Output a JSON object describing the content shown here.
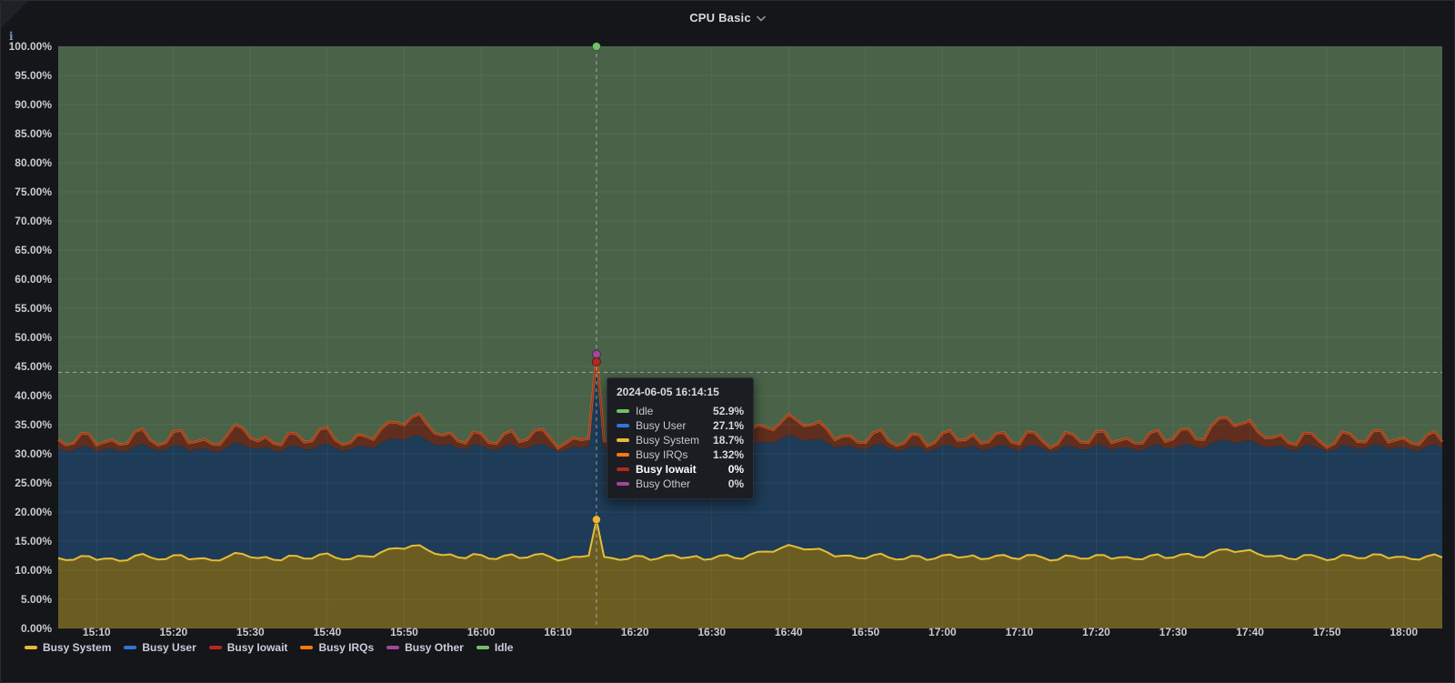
{
  "header": {
    "title": "CPU Basic",
    "info_icon_text": "i",
    "title_chevron_icon": "chevron-down"
  },
  "colors": {
    "panel_bg": "#141619",
    "panel_border": "#2b2c33",
    "axis_text": "#c9cbd1",
    "grid": "rgba(255,255,255,0.06)",
    "crosshair": "#b9c0c7",
    "tooltip_bg": "#1b1d23",
    "series": {
      "busy_system": "#EAB839",
      "busy_user": "#3274D9",
      "busy_iowait": "#B7271F",
      "busy_irqs": "#FF780A",
      "busy_other": "#A0479C",
      "idle": "#73BF69"
    },
    "fills": {
      "idle": "#4a6348",
      "busy_user": "#1e3b57",
      "busy_system": "#6b5d22",
      "iowait_irqs_fringe": "#5f2e1e"
    },
    "strokes": {
      "busy_system_line": "#e6bd37",
      "fringe_orange": "#d06a1f",
      "fringe_red": "#a03320"
    }
  },
  "tooltip": {
    "timestamp": "2024-06-05 16:14:15",
    "rows": [
      {
        "label": "Idle",
        "value": "52.9%",
        "color": "#73BF69",
        "bold": false
      },
      {
        "label": "Busy User",
        "value": "27.1%",
        "color": "#3274D9",
        "bold": false
      },
      {
        "label": "Busy System",
        "value": "18.7%",
        "color": "#EAB839",
        "bold": false
      },
      {
        "label": "Busy IRQs",
        "value": "1.32%",
        "color": "#FF780A",
        "bold": false
      },
      {
        "label": "Busy Iowait",
        "value": "0%",
        "color": "#B7271F",
        "bold": true
      },
      {
        "label": "Busy Other",
        "value": "0%",
        "color": "#A0479C",
        "bold": false
      }
    ]
  },
  "legend": {
    "items": [
      {
        "label": "Busy System",
        "color": "#EAB839"
      },
      {
        "label": "Busy User",
        "color": "#3274D9"
      },
      {
        "label": "Busy Iowait",
        "color": "#B7271F"
      },
      {
        "label": "Busy IRQs",
        "color": "#FF780A"
      },
      {
        "label": "Busy Other",
        "color": "#A0479C"
      },
      {
        "label": "Idle",
        "color": "#73BF69"
      }
    ]
  },
  "chart_data": {
    "type": "area",
    "stacked": true,
    "title": "CPU Basic",
    "unit": "percent",
    "ylim": [
      0,
      100
    ],
    "y_tick_step_pct": 5,
    "time_start": "15:05",
    "time_end": "18:05",
    "step_minutes": 2,
    "x_ticks": [
      "15:10",
      "15:20",
      "15:30",
      "15:40",
      "15:50",
      "16:00",
      "16:10",
      "16:20",
      "16:30",
      "16:40",
      "16:50",
      "17:00",
      "17:10",
      "17:20",
      "17:30",
      "17:40",
      "17:50",
      "18:00"
    ],
    "y_ticks": [
      "100.00%",
      "95.00%",
      "90.00%",
      "85.00%",
      "80.00%",
      "75.00%",
      "70.00%",
      "65.00%",
      "60.00%",
      "55.00%",
      "50.00%",
      "45.00%",
      "40.00%",
      "35.00%",
      "30.00%",
      "25.00%",
      "20.00%",
      "15.00%",
      "10.00%",
      "5.00%",
      "0.00%"
    ],
    "stack_tops": {
      "busy_system_pct": [
        12.1,
        11.8,
        12.4,
        12.0,
        11.6,
        12.5,
        12.2,
        11.9,
        12.6,
        12.0,
        11.7,
        12.3,
        12.8,
        12.1,
        11.8,
        12.5,
        12.0,
        12.7,
        12.2,
        11.9,
        12.4,
        13.1,
        13.8,
        14.2,
        13.5,
        12.6,
        12.2,
        12.8,
        12.0,
        12.5,
        12.1,
        12.7,
        12.3,
        11.9,
        12.3,
        18.7,
        12.1,
        11.9,
        12.4,
        12.0,
        12.6,
        12.2,
        11.8,
        12.5,
        12.1,
        12.7,
        13.2,
        13.8,
        14.0,
        13.6,
        13.1,
        12.5,
        12.1,
        12.6,
        12.2,
        11.9,
        12.4,
        12.0,
        12.7,
        12.3,
        11.9,
        12.5,
        12.1,
        12.6,
        12.2,
        11.8,
        12.4,
        12.0,
        12.6,
        12.2,
        11.9,
        12.5,
        12.1,
        12.7,
        12.3,
        13.0,
        13.6,
        13.3,
        12.8,
        12.4,
        12.0,
        12.6,
        12.2,
        11.9,
        12.5,
        12.1,
        12.7,
        12.3,
        11.9,
        12.4,
        12.2
      ],
      "busy_user_cum_pct": [
        30.9,
        30.6,
        31.2,
        30.8,
        30.5,
        31.3,
        31.0,
        30.7,
        31.4,
        30.8,
        30.5,
        31.1,
        31.6,
        30.9,
        30.6,
        31.3,
        30.8,
        31.5,
        31.0,
        30.7,
        31.2,
        31.9,
        32.6,
        33.0,
        32.3,
        31.4,
        31.0,
        31.6,
        30.8,
        31.3,
        30.9,
        31.5,
        31.1,
        30.7,
        31.1,
        45.8,
        30.9,
        30.7,
        31.2,
        30.8,
        31.4,
        31.0,
        30.6,
        31.3,
        30.9,
        31.5,
        32.0,
        32.6,
        32.8,
        32.4,
        31.9,
        31.3,
        30.9,
        31.4,
        31.0,
        30.7,
        31.2,
        30.8,
        31.5,
        31.1,
        30.7,
        31.3,
        30.9,
        31.4,
        31.0,
        30.6,
        31.2,
        30.8,
        31.4,
        31.0,
        30.7,
        31.3,
        30.9,
        31.5,
        31.1,
        31.8,
        32.4,
        32.1,
        31.6,
        31.2,
        30.8,
        31.4,
        31.0,
        30.7,
        31.3,
        30.9,
        31.5,
        31.1,
        30.7,
        31.2,
        31.0
      ],
      "busy_total_cum_pct": [
        32.4,
        31.8,
        33.4,
        32.0,
        31.6,
        33.8,
        32.3,
        31.9,
        34.0,
        32.1,
        31.7,
        33.2,
        34.4,
        32.2,
        31.8,
        33.6,
        32.0,
        34.2,
        32.4,
        31.9,
        33.0,
        34.3,
        35.4,
        36.3,
        35.0,
        33.2,
        32.2,
        33.8,
        31.9,
        33.4,
        32.1,
        34.0,
        32.6,
        31.8,
        32.4,
        47.1,
        32.0,
        31.8,
        33.2,
        31.9,
        33.8,
        32.3,
        31.7,
        33.5,
        32.0,
        34.1,
        34.6,
        35.4,
        35.8,
        35.0,
        34.2,
        33.0,
        32.0,
        33.6,
        32.2,
        31.8,
        33.2,
        31.9,
        34.0,
        32.4,
        31.8,
        33.5,
        32.0,
        33.8,
        32.2,
        31.7,
        33.3,
        31.9,
        33.9,
        32.3,
        31.8,
        33.6,
        32.1,
        34.2,
        32.5,
        34.8,
        36.2,
        35.2,
        33.8,
        32.8,
        31.9,
        33.6,
        32.2,
        31.8,
        33.4,
        32.0,
        34.0,
        32.4,
        31.8,
        33.2,
        32.1
      ]
    },
    "idle_top_pct": 100,
    "hover": {
      "date_time": "2024-06-05 16:14:15",
      "crosshair_time": "16:15:00",
      "crosshair_y_pct": 44,
      "points": [
        {
          "series": "Idle",
          "stack_pct": 100,
          "color": "#73BF69"
        },
        {
          "series": "Busy IRQs",
          "stack_pct": 47.1,
          "color": "#FF780A"
        },
        {
          "series": "Busy Other",
          "stack_pct": 47.1,
          "color": "#A0479C"
        },
        {
          "series": "Busy User",
          "stack_pct": 45.8,
          "color": "#3274D9"
        },
        {
          "series": "Busy Iowait",
          "stack_pct": 45.8,
          "color": "#B7271F"
        },
        {
          "series": "Busy System",
          "stack_pct": 18.7,
          "color": "#EAB839"
        }
      ]
    }
  }
}
